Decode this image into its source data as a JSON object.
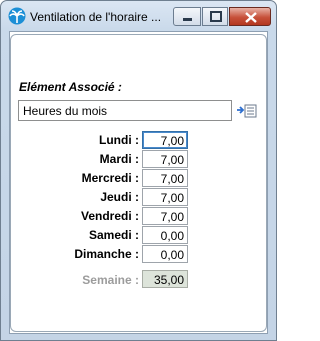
{
  "window": {
    "title": "Ventilation de l'horaire ...",
    "icon": "palm-tree-icon"
  },
  "associated": {
    "label": "Elément Associé :",
    "value": "Heures du mois",
    "button_icon": "arrow-list-icon"
  },
  "days": [
    {
      "label": "Lundi :",
      "value": "7,00"
    },
    {
      "label": "Mardi :",
      "value": "7,00"
    },
    {
      "label": "Mercredi :",
      "value": "7,00"
    },
    {
      "label": "Jeudi :",
      "value": "7,00"
    },
    {
      "label": "Vendredi :",
      "value": "7,00"
    },
    {
      "label": "Samedi :",
      "value": "0,00"
    },
    {
      "label": "Dimanche :",
      "value": "0,00"
    }
  ],
  "week": {
    "label": "Semaine :",
    "value": "35,00"
  },
  "colors": {
    "title_bg": "#c9d9ea",
    "close_btn": "#c7513a",
    "total_bg": "#dde4da"
  }
}
